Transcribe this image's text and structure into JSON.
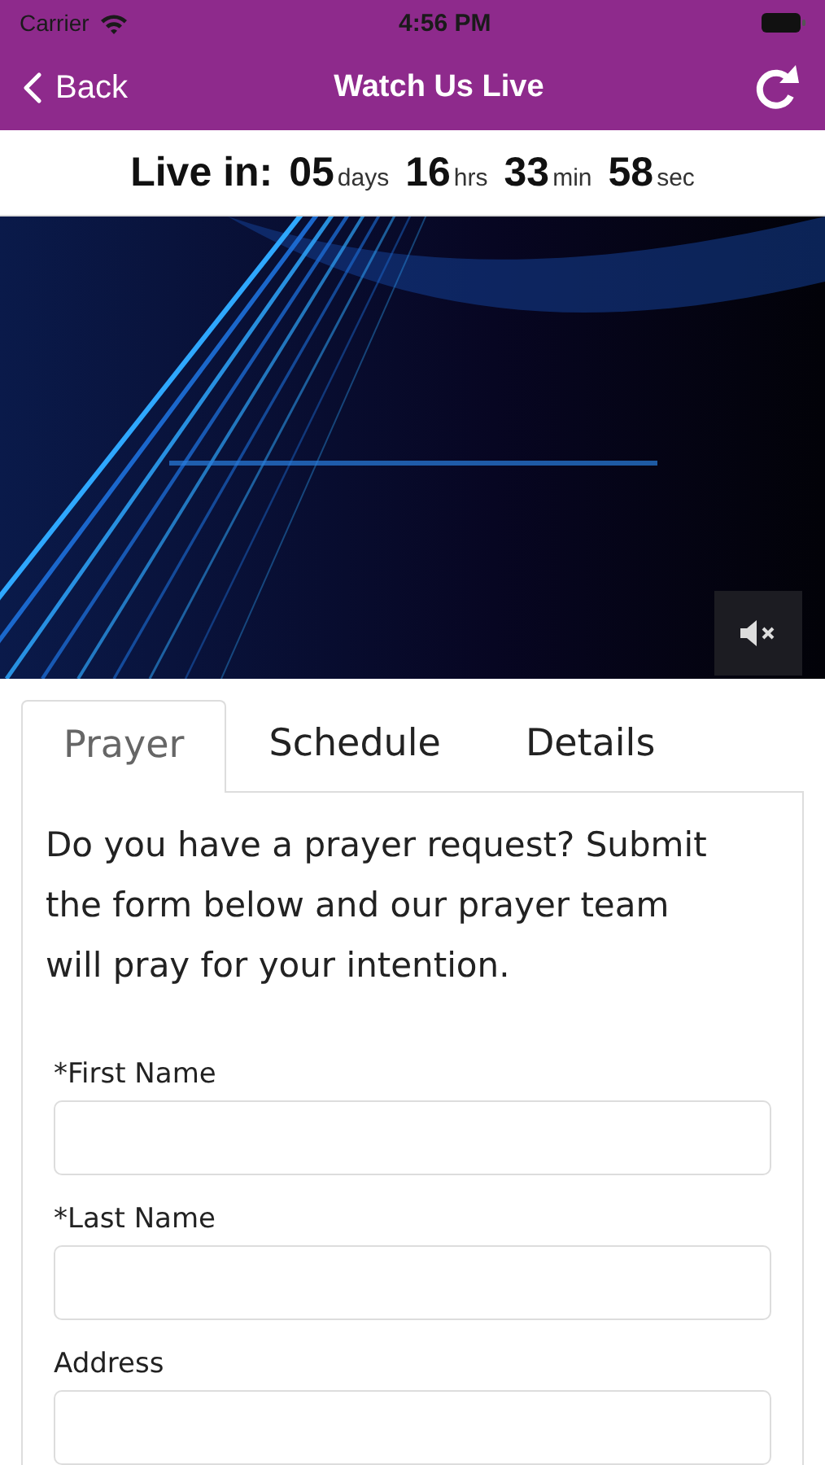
{
  "status_bar": {
    "carrier": "Carrier",
    "time": "4:56 PM"
  },
  "nav": {
    "back": "Back",
    "title": "Watch Us Live"
  },
  "countdown": {
    "label": "Live in:",
    "units": [
      {
        "value": "05",
        "unit": "days"
      },
      {
        "value": "16",
        "unit": "hrs"
      },
      {
        "value": "33",
        "unit": "min"
      },
      {
        "value": "58",
        "unit": "sec"
      }
    ]
  },
  "video": {
    "kind": "picture",
    "muted": true
  },
  "tabs": [
    {
      "label": "Prayer",
      "selected": true
    },
    {
      "label": "Schedule",
      "selected": false
    },
    {
      "label": "Details",
      "selected": false
    }
  ],
  "intro": "Do you have a prayer request? Submit the form below and our prayer team will pray for your intention.",
  "fields": [
    {
      "label": "*First Name"
    },
    {
      "label": "*Last Name"
    },
    {
      "label": "Address"
    }
  ]
}
